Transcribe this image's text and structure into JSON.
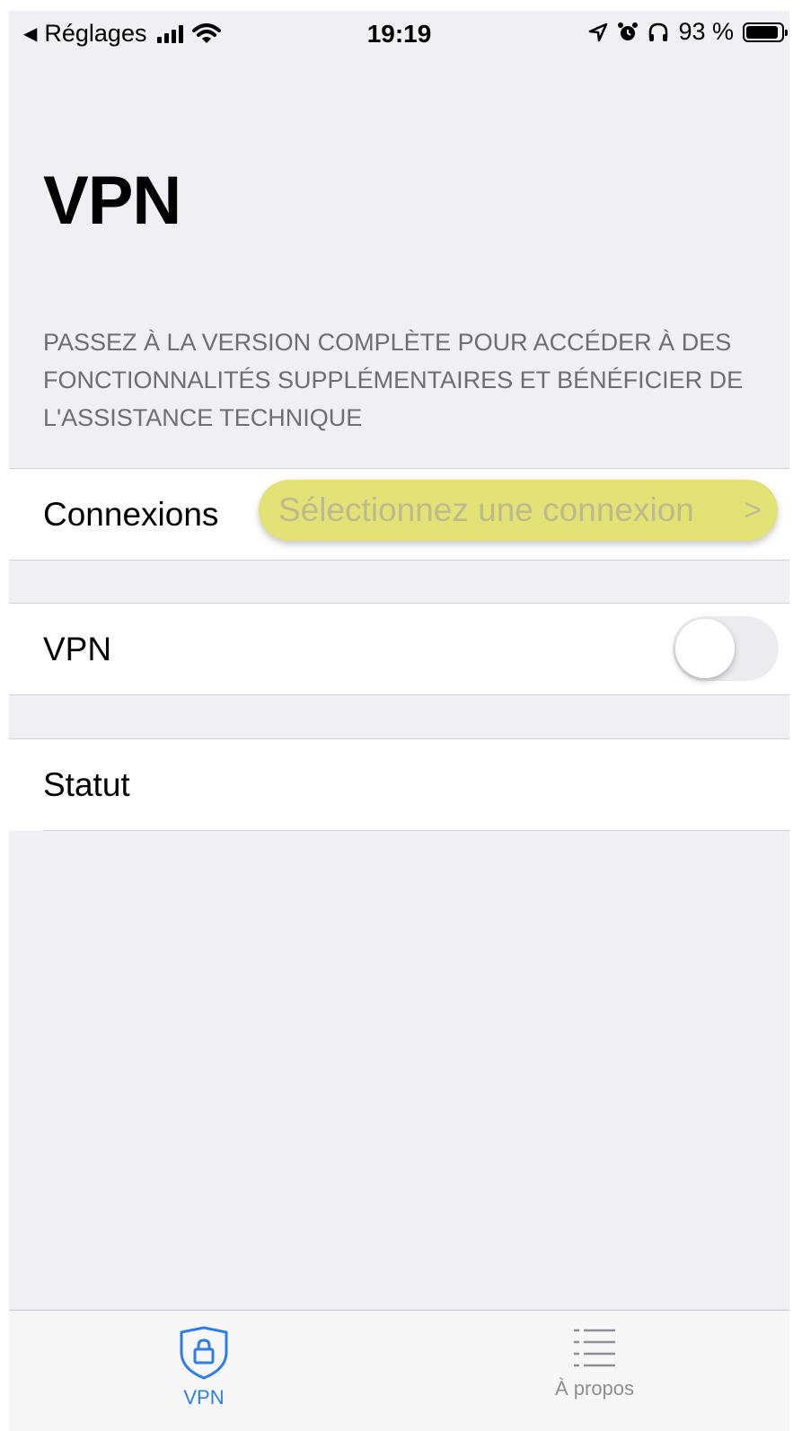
{
  "status_bar": {
    "back_label": "Réglages",
    "time": "19:19",
    "battery_percent": "93 %",
    "battery_level": 0.93
  },
  "page": {
    "title": "VPN",
    "upgrade_notice": "PASSEZ À LA VERSION COMPLÈTE POUR ACCÉDER À DES FONCTIONNALITÉS SUPPLÉMENTAIRES ET BÉNÉFICIER DE L'ASSISTANCE TECHNIQUE"
  },
  "connexions": {
    "label": "Connexions",
    "picker_placeholder": "Sélectionnez une connexion",
    "highlight_color": "#e3e276"
  },
  "vpn_row": {
    "label": "VPN",
    "toggle_on": false
  },
  "statut_row": {
    "label": "Statut"
  },
  "tabbar": {
    "tabs": [
      {
        "label": "VPN",
        "icon": "shield-lock-icon",
        "active": true
      },
      {
        "label": "À propos",
        "icon": "list-icon",
        "active": false
      }
    ],
    "active_color": "#2f7ee8",
    "inactive_color": "#8e8e93"
  }
}
